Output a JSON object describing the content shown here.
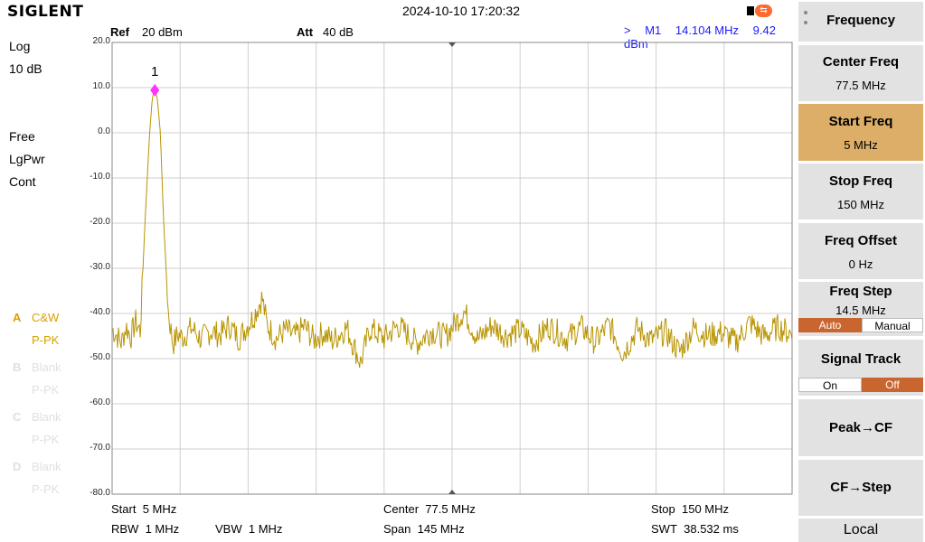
{
  "header": {
    "brand": "SIGLENT",
    "datetime": "2024-10-10 17:20:32",
    "usb_icon": "usb-icon"
  },
  "left_panel": {
    "scale_type": "Log",
    "scale_div": "10 dB",
    "trigger": "Free",
    "detector_mode": "LgPwr",
    "sweep_mode": "Cont",
    "traces": [
      {
        "letter": "A",
        "mode": "C&W",
        "detector": "P-PK",
        "active": true
      },
      {
        "letter": "B",
        "mode": "Blank",
        "detector": "P-PK",
        "active": false
      },
      {
        "letter": "C",
        "mode": "Blank",
        "detector": "P-PK",
        "active": false
      },
      {
        "letter": "D",
        "mode": "Blank",
        "detector": "P-PK",
        "active": false
      }
    ]
  },
  "plot_header": {
    "ref_label": "Ref",
    "ref_value": "20 dBm",
    "att_label": "Att",
    "att_value": "40 dB",
    "marker_arrow": ">",
    "marker_name": "M1",
    "marker_freq": "14.104 MHz",
    "marker_level": "9.42 dBm"
  },
  "y_ticks": [
    "20.0",
    "10.0",
    "0.0",
    "-10.0",
    "-20.0",
    "-30.0",
    "-40.0",
    "-50.0",
    "-60.0",
    "-70.0",
    "-80.0"
  ],
  "marker_label": "1",
  "chart_data": {
    "type": "line",
    "ylim": [
      -80,
      20
    ],
    "xlim": [
      5,
      150
    ],
    "grid": true,
    "trace_color": "#b89400",
    "marker_color": "#ff33ff",
    "noise_floor_dbm": -44.5,
    "peak": {
      "freq_mhz": 14.104,
      "level_dbm": 9.42
    },
    "points": [
      [
        5,
        -43.5
      ],
      [
        6,
        -44.8
      ],
      [
        7,
        -46.5
      ],
      [
        8,
        -42.9
      ],
      [
        9,
        -45.2
      ],
      [
        10,
        -41.8
      ],
      [
        11,
        -44.0
      ],
      [
        12,
        -20
      ],
      [
        13,
        0
      ],
      [
        13.6,
        8
      ],
      [
        14.104,
        9.42
      ],
      [
        14.6,
        8
      ],
      [
        15.3,
        0
      ],
      [
        16,
        -20
      ],
      [
        17,
        -40
      ],
      [
        18,
        -46.8
      ],
      [
        19,
        -44.6
      ],
      [
        20,
        -45.3
      ],
      [
        22,
        -43.2
      ],
      [
        24,
        -45.7
      ],
      [
        26,
        -43.9
      ],
      [
        28,
        -44.8
      ],
      [
        30,
        -42.6
      ],
      [
        32,
        -45.5
      ],
      [
        35,
        -41.0
      ],
      [
        37,
        -36.5
      ],
      [
        38,
        -42.5
      ],
      [
        40,
        -45.6
      ],
      [
        42,
        -43.6
      ],
      [
        44,
        -45.1
      ],
      [
        46,
        -42.8
      ],
      [
        48,
        -45.8
      ],
      [
        50,
        -44.3
      ],
      [
        52,
        -46.0
      ],
      [
        55,
        -43.1
      ],
      [
        58,
        -51.0
      ],
      [
        60,
        -43.3
      ],
      [
        63,
        -45.5
      ],
      [
        66,
        -42.7
      ],
      [
        70,
        -46.6
      ],
      [
        73,
        -43.8
      ],
      [
        76,
        -45.2
      ],
      [
        80,
        -39.4
      ],
      [
        83,
        -45.8
      ],
      [
        86,
        -42.6
      ],
      [
        89,
        -44.9
      ],
      [
        92,
        -43.7
      ],
      [
        95,
        -46.5
      ],
      [
        98,
        -42.8
      ],
      [
        102,
        -45.6
      ],
      [
        105,
        -43.0
      ],
      [
        108,
        -46.3
      ],
      [
        111,
        -42.5
      ],
      [
        114,
        -48.8
      ],
      [
        117,
        -43.4
      ],
      [
        120,
        -45.9
      ],
      [
        123,
        -44.0
      ],
      [
        126,
        -48.5
      ],
      [
        129,
        -43.2
      ],
      [
        132,
        -45.0
      ],
      [
        135,
        -44.2
      ],
      [
        138,
        -46.4
      ],
      [
        141,
        -42.0
      ],
      [
        144,
        -45.1
      ],
      [
        147,
        -43.0
      ],
      [
        150,
        -44.6
      ]
    ]
  },
  "bottom": {
    "start_label": "Start",
    "start_value": "5 MHz",
    "center_label": "Center",
    "center_value": "77.5 MHz",
    "stop_label": "Stop",
    "stop_value": "150 MHz",
    "rbw_label": "RBW",
    "rbw_value": "1 MHz",
    "vbw_label": "VBW",
    "vbw_value": "1 MHz",
    "span_label": "Span",
    "span_value": "145 MHz",
    "swt_label": "SWT",
    "swt_value": "38.532 ms"
  },
  "menu": {
    "title": "Frequency",
    "center_freq_label": "Center Freq",
    "center_freq_value": "77.5 MHz",
    "start_freq_label": "Start Freq",
    "start_freq_value": "5 MHz",
    "stop_freq_label": "Stop Freq",
    "stop_freq_value": "150 MHz",
    "freq_offset_label": "Freq Offset",
    "freq_offset_value": "0 Hz",
    "freq_step_label": "Freq Step",
    "freq_step_value": "14.5 MHz",
    "freq_step_auto": "Auto",
    "freq_step_manual": "Manual",
    "signal_track_label": "Signal Track",
    "signal_track_on": "On",
    "signal_track_off": "Off",
    "peak_cf": "Peak→CF",
    "cf_step": "CF→Step",
    "local": "Local"
  }
}
